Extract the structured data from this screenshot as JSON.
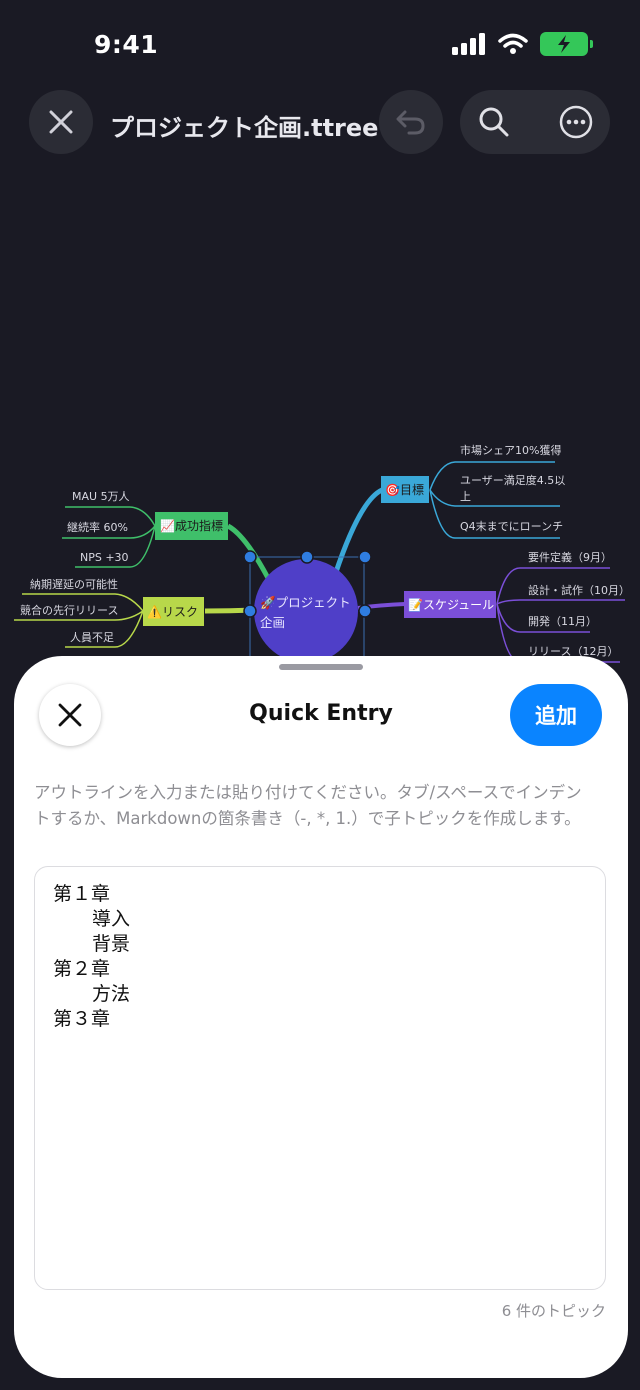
{
  "status_bar": {
    "time": "9:41"
  },
  "toolbar": {
    "file_title": "プロジェクト企画.ttree"
  },
  "mindmap": {
    "central": {
      "icon": "🚀",
      "line1": "プロジェクト",
      "line2": "企画"
    },
    "branches": {
      "goals": {
        "icon": "🎯",
        "label": "目標",
        "children": [
          "市場シェア10%獲得",
          "ユーザー満足度4.5以",
          "上",
          "Q4末までにローンチ"
        ]
      },
      "schedule": {
        "icon": "📝",
        "label": "スケジュール",
        "children": [
          "要件定義（9月）",
          "設計・試作（10月）",
          "開発（11月）",
          "リリース（12月）"
        ]
      },
      "metrics": {
        "icon": "📈",
        "label": "成功指標",
        "children": [
          "MAU 5万人",
          "継続率 60%",
          "NPS +30"
        ]
      },
      "risks": {
        "icon": "⚠️",
        "label": "リスク",
        "children": [
          "納期遅延の可能性",
          "競合の先行リリース",
          "人員不足"
        ]
      }
    },
    "colors": {
      "goals": "#3aa8d8",
      "schedule": "#7b4fd8",
      "metrics": "#3fbf6a",
      "risks": "#b8d84a",
      "central": "#4f3fc8",
      "handle": "#2f7de0"
    }
  },
  "sheet": {
    "title": "Quick Entry",
    "add_label": "追加",
    "instructions": "アウトラインを入力または貼り付けてください。タブ/スペースでインデントするか、Markdownの箇条書き（-, *, 1.）で子トピックを作成します。",
    "outline": [
      {
        "text": "第１章",
        "indent": 0
      },
      {
        "text": "導入",
        "indent": 1
      },
      {
        "text": "背景",
        "indent": 1
      },
      {
        "text": "第２章",
        "indent": 0
      },
      {
        "text": "方法",
        "indent": 1
      },
      {
        "text": "第３章",
        "indent": 0
      }
    ],
    "topic_count": "6 件のトピック"
  }
}
